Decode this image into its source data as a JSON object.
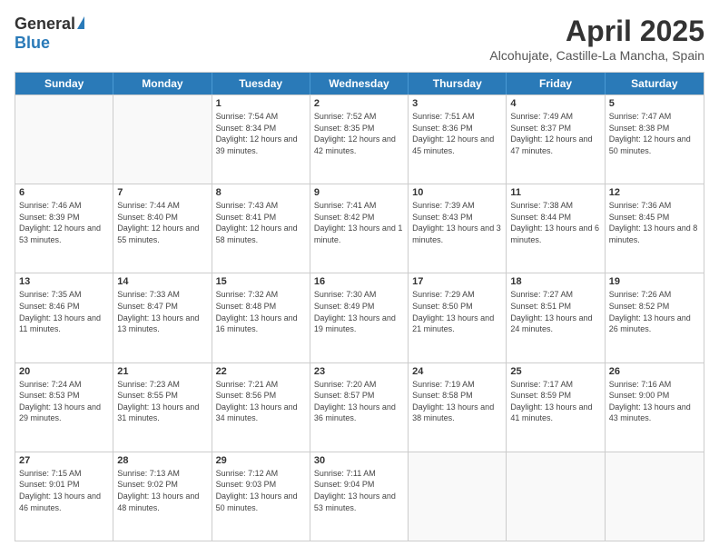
{
  "logo": {
    "general": "General",
    "blue": "Blue"
  },
  "title": {
    "month": "April 2025",
    "location": "Alcohujate, Castille-La Mancha, Spain"
  },
  "header_days": [
    "Sunday",
    "Monday",
    "Tuesday",
    "Wednesday",
    "Thursday",
    "Friday",
    "Saturday"
  ],
  "weeks": [
    [
      {
        "day": "",
        "info": ""
      },
      {
        "day": "",
        "info": ""
      },
      {
        "day": "1",
        "info": "Sunrise: 7:54 AM\nSunset: 8:34 PM\nDaylight: 12 hours and 39 minutes."
      },
      {
        "day": "2",
        "info": "Sunrise: 7:52 AM\nSunset: 8:35 PM\nDaylight: 12 hours and 42 minutes."
      },
      {
        "day": "3",
        "info": "Sunrise: 7:51 AM\nSunset: 8:36 PM\nDaylight: 12 hours and 45 minutes."
      },
      {
        "day": "4",
        "info": "Sunrise: 7:49 AM\nSunset: 8:37 PM\nDaylight: 12 hours and 47 minutes."
      },
      {
        "day": "5",
        "info": "Sunrise: 7:47 AM\nSunset: 8:38 PM\nDaylight: 12 hours and 50 minutes."
      }
    ],
    [
      {
        "day": "6",
        "info": "Sunrise: 7:46 AM\nSunset: 8:39 PM\nDaylight: 12 hours and 53 minutes."
      },
      {
        "day": "7",
        "info": "Sunrise: 7:44 AM\nSunset: 8:40 PM\nDaylight: 12 hours and 55 minutes."
      },
      {
        "day": "8",
        "info": "Sunrise: 7:43 AM\nSunset: 8:41 PM\nDaylight: 12 hours and 58 minutes."
      },
      {
        "day": "9",
        "info": "Sunrise: 7:41 AM\nSunset: 8:42 PM\nDaylight: 13 hours and 1 minute."
      },
      {
        "day": "10",
        "info": "Sunrise: 7:39 AM\nSunset: 8:43 PM\nDaylight: 13 hours and 3 minutes."
      },
      {
        "day": "11",
        "info": "Sunrise: 7:38 AM\nSunset: 8:44 PM\nDaylight: 13 hours and 6 minutes."
      },
      {
        "day": "12",
        "info": "Sunrise: 7:36 AM\nSunset: 8:45 PM\nDaylight: 13 hours and 8 minutes."
      }
    ],
    [
      {
        "day": "13",
        "info": "Sunrise: 7:35 AM\nSunset: 8:46 PM\nDaylight: 13 hours and 11 minutes."
      },
      {
        "day": "14",
        "info": "Sunrise: 7:33 AM\nSunset: 8:47 PM\nDaylight: 13 hours and 13 minutes."
      },
      {
        "day": "15",
        "info": "Sunrise: 7:32 AM\nSunset: 8:48 PM\nDaylight: 13 hours and 16 minutes."
      },
      {
        "day": "16",
        "info": "Sunrise: 7:30 AM\nSunset: 8:49 PM\nDaylight: 13 hours and 19 minutes."
      },
      {
        "day": "17",
        "info": "Sunrise: 7:29 AM\nSunset: 8:50 PM\nDaylight: 13 hours and 21 minutes."
      },
      {
        "day": "18",
        "info": "Sunrise: 7:27 AM\nSunset: 8:51 PM\nDaylight: 13 hours and 24 minutes."
      },
      {
        "day": "19",
        "info": "Sunrise: 7:26 AM\nSunset: 8:52 PM\nDaylight: 13 hours and 26 minutes."
      }
    ],
    [
      {
        "day": "20",
        "info": "Sunrise: 7:24 AM\nSunset: 8:53 PM\nDaylight: 13 hours and 29 minutes."
      },
      {
        "day": "21",
        "info": "Sunrise: 7:23 AM\nSunset: 8:55 PM\nDaylight: 13 hours and 31 minutes."
      },
      {
        "day": "22",
        "info": "Sunrise: 7:21 AM\nSunset: 8:56 PM\nDaylight: 13 hours and 34 minutes."
      },
      {
        "day": "23",
        "info": "Sunrise: 7:20 AM\nSunset: 8:57 PM\nDaylight: 13 hours and 36 minutes."
      },
      {
        "day": "24",
        "info": "Sunrise: 7:19 AM\nSunset: 8:58 PM\nDaylight: 13 hours and 38 minutes."
      },
      {
        "day": "25",
        "info": "Sunrise: 7:17 AM\nSunset: 8:59 PM\nDaylight: 13 hours and 41 minutes."
      },
      {
        "day": "26",
        "info": "Sunrise: 7:16 AM\nSunset: 9:00 PM\nDaylight: 13 hours and 43 minutes."
      }
    ],
    [
      {
        "day": "27",
        "info": "Sunrise: 7:15 AM\nSunset: 9:01 PM\nDaylight: 13 hours and 46 minutes."
      },
      {
        "day": "28",
        "info": "Sunrise: 7:13 AM\nSunset: 9:02 PM\nDaylight: 13 hours and 48 minutes."
      },
      {
        "day": "29",
        "info": "Sunrise: 7:12 AM\nSunset: 9:03 PM\nDaylight: 13 hours and 50 minutes."
      },
      {
        "day": "30",
        "info": "Sunrise: 7:11 AM\nSunset: 9:04 PM\nDaylight: 13 hours and 53 minutes."
      },
      {
        "day": "",
        "info": ""
      },
      {
        "day": "",
        "info": ""
      },
      {
        "day": "",
        "info": ""
      }
    ]
  ]
}
